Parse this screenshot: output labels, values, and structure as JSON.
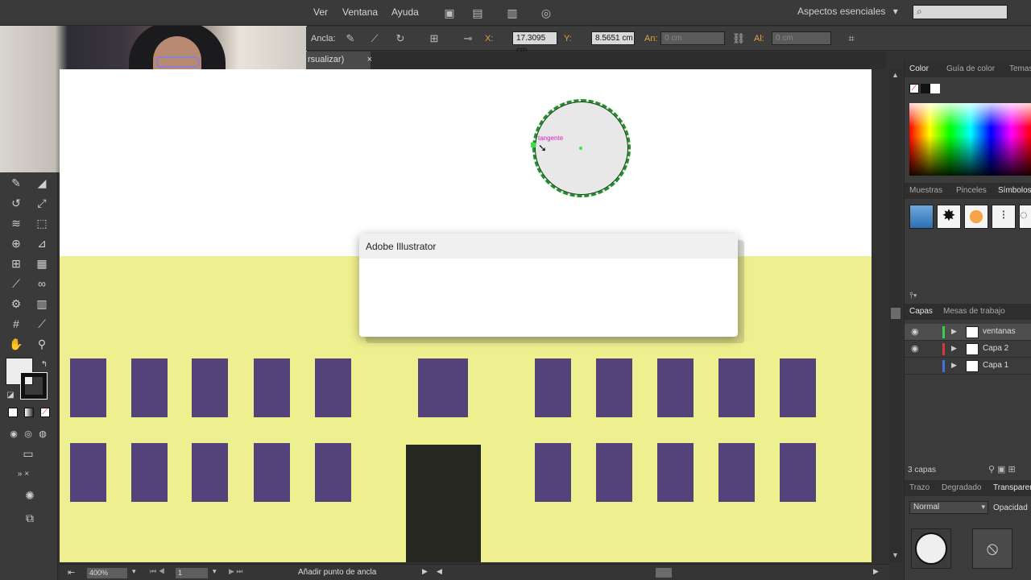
{
  "menubar": {
    "items": [
      "Ver",
      "Ventana",
      "Ayuda"
    ],
    "workspace_label": "Aspectos esenciales",
    "workspace_caret": "▾",
    "search_glyph": "⌕"
  },
  "controlbar": {
    "anchors_label": "Ancla:",
    "x_label": "X:",
    "x_value": "17.3095 cm",
    "y_label": "Y:",
    "y_value": "8.5651 cm",
    "w_label": "An:",
    "w_value": "0 cm",
    "h_label": "Al:",
    "h_value": "0 cm"
  },
  "document_tab": {
    "label": "rsualizar)",
    "close": "×"
  },
  "canvas": {
    "smart_guide_label": "tangente",
    "building_color": "#eeef8f",
    "window_color": "#54437a",
    "door_color": "#262720"
  },
  "dialog": {
    "title": "Adobe Illustrator"
  },
  "statusbar": {
    "zoom": "400%",
    "artboard": "1",
    "tool_text": "Añadir punto de ancla"
  },
  "panels": {
    "color_tabs": [
      "Color",
      "Guía de color",
      "Temas"
    ],
    "symbols_tabs": [
      "Muestras",
      "Pinceles",
      "Símbolos"
    ],
    "layers_tabs": [
      "Capas",
      "Mesas de trabajo"
    ],
    "layers": [
      {
        "name": "ventanas",
        "color": "#3ecf4a",
        "visible": true,
        "selected": true
      },
      {
        "name": "Capa 2",
        "color": "#d33b3b",
        "visible": true,
        "selected": false
      },
      {
        "name": "Capa 1",
        "color": "#4470d8",
        "visible": false,
        "selected": false
      }
    ],
    "layers_count": "3 capas",
    "bottom_tabs": [
      "Trazo",
      "Degradado",
      "Transparencia"
    ],
    "blend_mode": "Normal",
    "opacity_label": "Opacidad"
  }
}
